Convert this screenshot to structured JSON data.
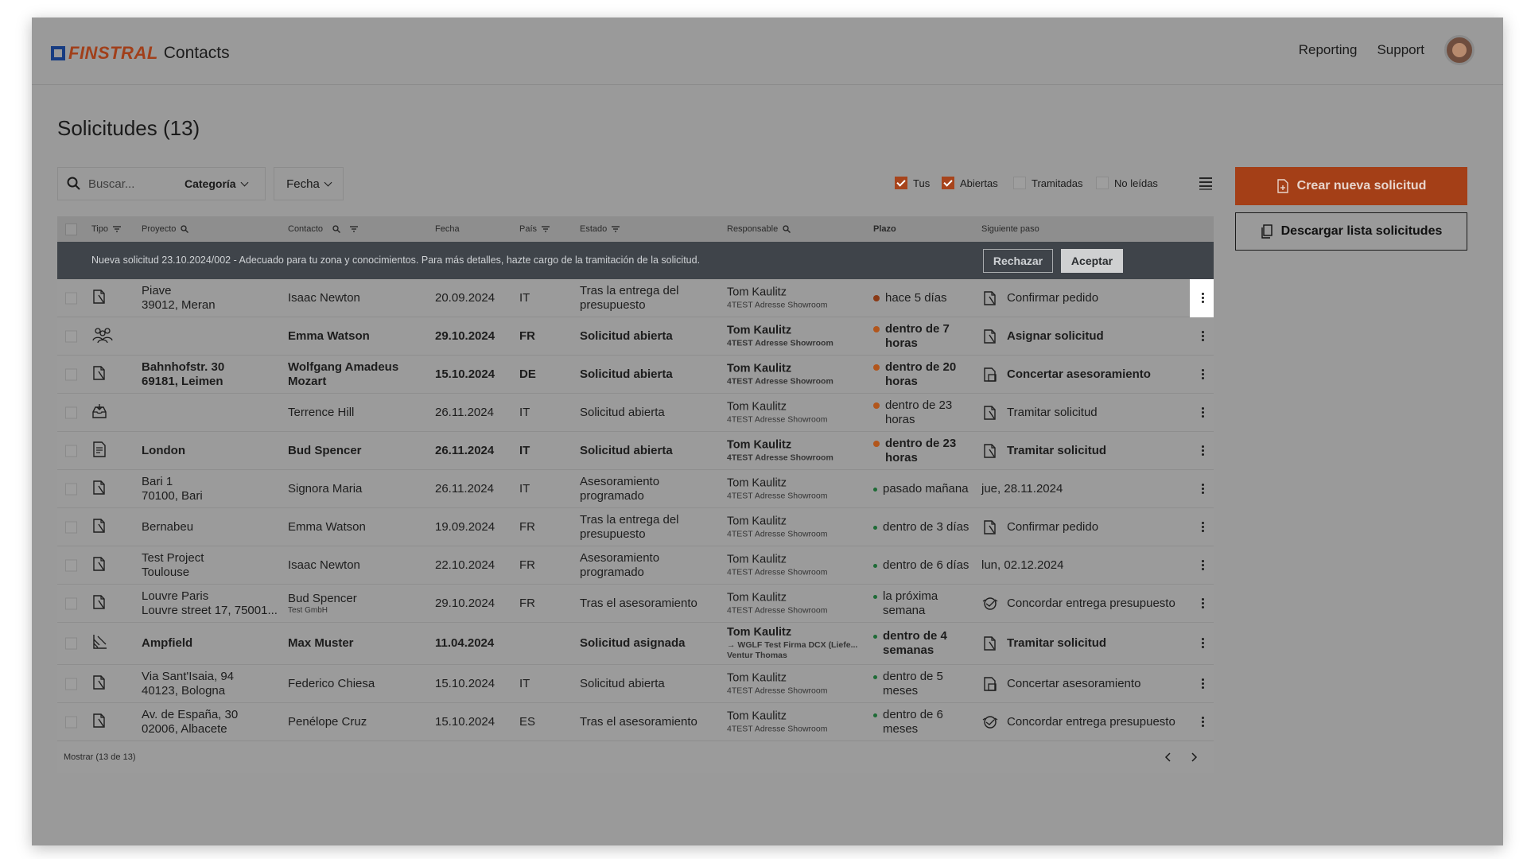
{
  "app": {
    "brand": "FINSTRAL",
    "product": "Contacts",
    "nav": [
      "Reporting",
      "Support"
    ]
  },
  "page": {
    "title": "Solicitudes (13)"
  },
  "filters": {
    "search_placeholder": "Buscar...",
    "category_label": "Categoría",
    "date_label": "Fecha",
    "checkboxes": [
      {
        "label": "Tus",
        "checked": true
      },
      {
        "label": "Abiertas",
        "checked": true
      },
      {
        "label": "Tramitadas",
        "checked": false
      },
      {
        "label": "No leídas",
        "checked": false
      }
    ]
  },
  "actions": {
    "create": "Crear nueva solicitud",
    "download": "Descargar lista solicitudes"
  },
  "table": {
    "headers": {
      "type": "Tipo",
      "project": "Proyecto",
      "contact": "Contacto",
      "date": "Fecha",
      "country": "País",
      "status": "Estado",
      "responsible": "Responsable",
      "deadline": "Plazo",
      "next": "Siguiente paso"
    },
    "notice": {
      "text": "Nueva solicitud 23.10.2024/002 - Adecuado para tu zona y conocimientos. Para más detalles, hazte cargo de la tramitación de la solicitud.",
      "reject": "Rechazar",
      "accept": "Aceptar"
    },
    "rows": [
      {
        "type_icon": "document-icon",
        "bold": false,
        "proj1": "Piave",
        "proj2": "39012, Meran",
        "contact": "Isaac Newton",
        "contact_sub": "",
        "date": "20.09.2024",
        "country": "IT",
        "status": "Tras la entrega del presupuesto",
        "resp": "Tom Kaulitz",
        "resp_sub": "4TEST Adresse Showroom",
        "deadline": "hace 5 días",
        "dot": "#8a3a16",
        "dot_size": "big",
        "next_icon": "document-icon",
        "next": "Confirmar pedido"
      },
      {
        "type_icon": "group-icon",
        "bold": true,
        "proj1": "",
        "proj2": "",
        "contact": "Emma Watson",
        "contact_sub": "",
        "date": "29.10.2024",
        "country": "FR",
        "status": "Solicitud abierta",
        "resp": "Tom Kaulitz",
        "resp_sub": "4TEST Adresse Showroom",
        "deadline": "dentro de 7 horas",
        "dot": "#b2561c",
        "dot_size": "big",
        "next_icon": "document-icon",
        "next": "Asignar solicitud"
      },
      {
        "type_icon": "document-icon",
        "bold": true,
        "proj1": "Bahnhofstr. 30",
        "proj2": "69181, Leimen",
        "contact": "Wolfgang Amadeus Mozart",
        "contact_sub": "",
        "date": "15.10.2024",
        "country": "DE",
        "status": "Solicitud abierta",
        "resp": "Tom Kaulitz",
        "resp_sub": "4TEST Adresse Showroom",
        "deadline": "dentro de 20 horas",
        "dot": "#b2561c",
        "dot_size": "big",
        "next_icon": "document-calendar-icon",
        "next": "Concertar asesoramiento"
      },
      {
        "type_icon": "inbox-icon",
        "bold": false,
        "proj1": "",
        "proj2": "",
        "contact": "Terrence Hill",
        "contact_sub": "",
        "date": "26.11.2024",
        "country": "IT",
        "status": "Solicitud abierta",
        "resp": "Tom Kaulitz",
        "resp_sub": "4TEST Adresse Showroom",
        "deadline": "dentro de 23 horas",
        "dot": "#b2561c",
        "dot_size": "big",
        "next_icon": "document-icon",
        "next": "Tramitar solicitud"
      },
      {
        "type_icon": "form-icon",
        "bold": true,
        "proj1": "London",
        "proj2": "",
        "contact": "Bud Spencer",
        "contact_sub": "",
        "date": "26.11.2024",
        "country": "IT",
        "status": "Solicitud abierta",
        "resp": "Tom Kaulitz",
        "resp_sub": "4TEST Adresse Showroom",
        "deadline": "dentro de 23 horas",
        "dot": "#b2561c",
        "dot_size": "big",
        "next_icon": "document-icon",
        "next": "Tramitar solicitud"
      },
      {
        "type_icon": "document-icon",
        "bold": false,
        "proj1": "Bari 1",
        "proj2": "70100, Bari",
        "contact": "Signora Maria",
        "contact_sub": "",
        "date": "26.11.2024",
        "country": "IT",
        "status": "Asesoramiento programado",
        "resp": "Tom Kaulitz",
        "resp_sub": "4TEST Adresse Showroom",
        "deadline": "pasado mañana",
        "dot": "#1e6b36",
        "dot_size": "small",
        "next_icon": "",
        "next": "jue, 28.11.2024"
      },
      {
        "type_icon": "document-icon",
        "bold": false,
        "proj1": "Bernabeu",
        "proj2": "",
        "contact": "Emma Watson",
        "contact_sub": "",
        "date": "19.09.2024",
        "country": "FR",
        "status": "Tras la entrega del presupuesto",
        "resp": "Tom Kaulitz",
        "resp_sub": "4TEST Adresse Showroom",
        "deadline": "dentro de 3 días",
        "dot": "#1e6b36",
        "dot_size": "small",
        "next_icon": "document-icon",
        "next": "Confirmar pedido"
      },
      {
        "type_icon": "document-icon",
        "bold": false,
        "proj1": "Test Project",
        "proj2": "Toulouse",
        "contact": "Isaac Newton",
        "contact_sub": "",
        "date": "22.10.2024",
        "country": "FR",
        "status": "Asesoramiento programado",
        "resp": "Tom Kaulitz",
        "resp_sub": "4TEST Adresse Showroom",
        "deadline": "dentro de 6 días",
        "dot": "#1e6b36",
        "dot_size": "small",
        "next_icon": "",
        "next": "lun, 02.12.2024"
      },
      {
        "type_icon": "document-icon",
        "bold": false,
        "proj1": "Louvre Paris",
        "proj2": "Louvre street 17, 75001...",
        "contact": "Bud Spencer",
        "contact_sub": "Test GmbH",
        "date": "29.10.2024",
        "country": "FR",
        "status": "Tras el asesoramiento",
        "resp": "Tom Kaulitz",
        "resp_sub": "4TEST Adresse Showroom",
        "deadline": "la próxima semana",
        "dot": "#1e6b36",
        "dot_size": "small",
        "next_icon": "handshake-icon",
        "next": "Concordar entrega presupuesto"
      },
      {
        "type_icon": "drafting-icon",
        "bold": true,
        "tall": true,
        "proj1": "Ampfield",
        "proj2": "",
        "contact": "Max Muster",
        "contact_sub": "",
        "date": "11.04.2024",
        "country": "",
        "status": "Solicitud asignada",
        "resp": "Tom Kaulitz",
        "resp_sub": "→ WGLF Test Firma DCX (Liefe... Ventur Thomas",
        "deadline": "dentro de 4 semanas",
        "dot": "#1e6b36",
        "dot_size": "small",
        "next_icon": "document-icon",
        "next": "Tramitar solicitud"
      },
      {
        "type_icon": "document-icon",
        "bold": false,
        "proj1": "Via Sant'Isaia, 94",
        "proj2": "40123, Bologna",
        "contact": "Federico Chiesa",
        "contact_sub": "",
        "date": "15.10.2024",
        "country": "IT",
        "status": "Solicitud abierta",
        "resp": "Tom Kaulitz",
        "resp_sub": "4TEST Adresse Showroom",
        "deadline": "dentro de 5 meses",
        "dot": "#1e6b36",
        "dot_size": "small",
        "next_icon": "document-calendar-icon",
        "next": "Concertar asesoramiento"
      },
      {
        "type_icon": "document-icon",
        "bold": false,
        "proj1": "Av. de España, 30",
        "proj2": "02006, Albacete",
        "contact": "Penélope Cruz",
        "contact_sub": "",
        "date": "15.10.2024",
        "country": "ES",
        "status": "Tras el asesoramiento",
        "resp": "Tom Kaulitz",
        "resp_sub": "4TEST Adresse Showroom",
        "deadline": "dentro de 6 meses",
        "dot": "#1e6b36",
        "dot_size": "small",
        "next_icon": "handshake-icon",
        "next": "Concordar entrega presupuesto"
      }
    ],
    "footer": "Mostrar  (13 de 13)"
  }
}
